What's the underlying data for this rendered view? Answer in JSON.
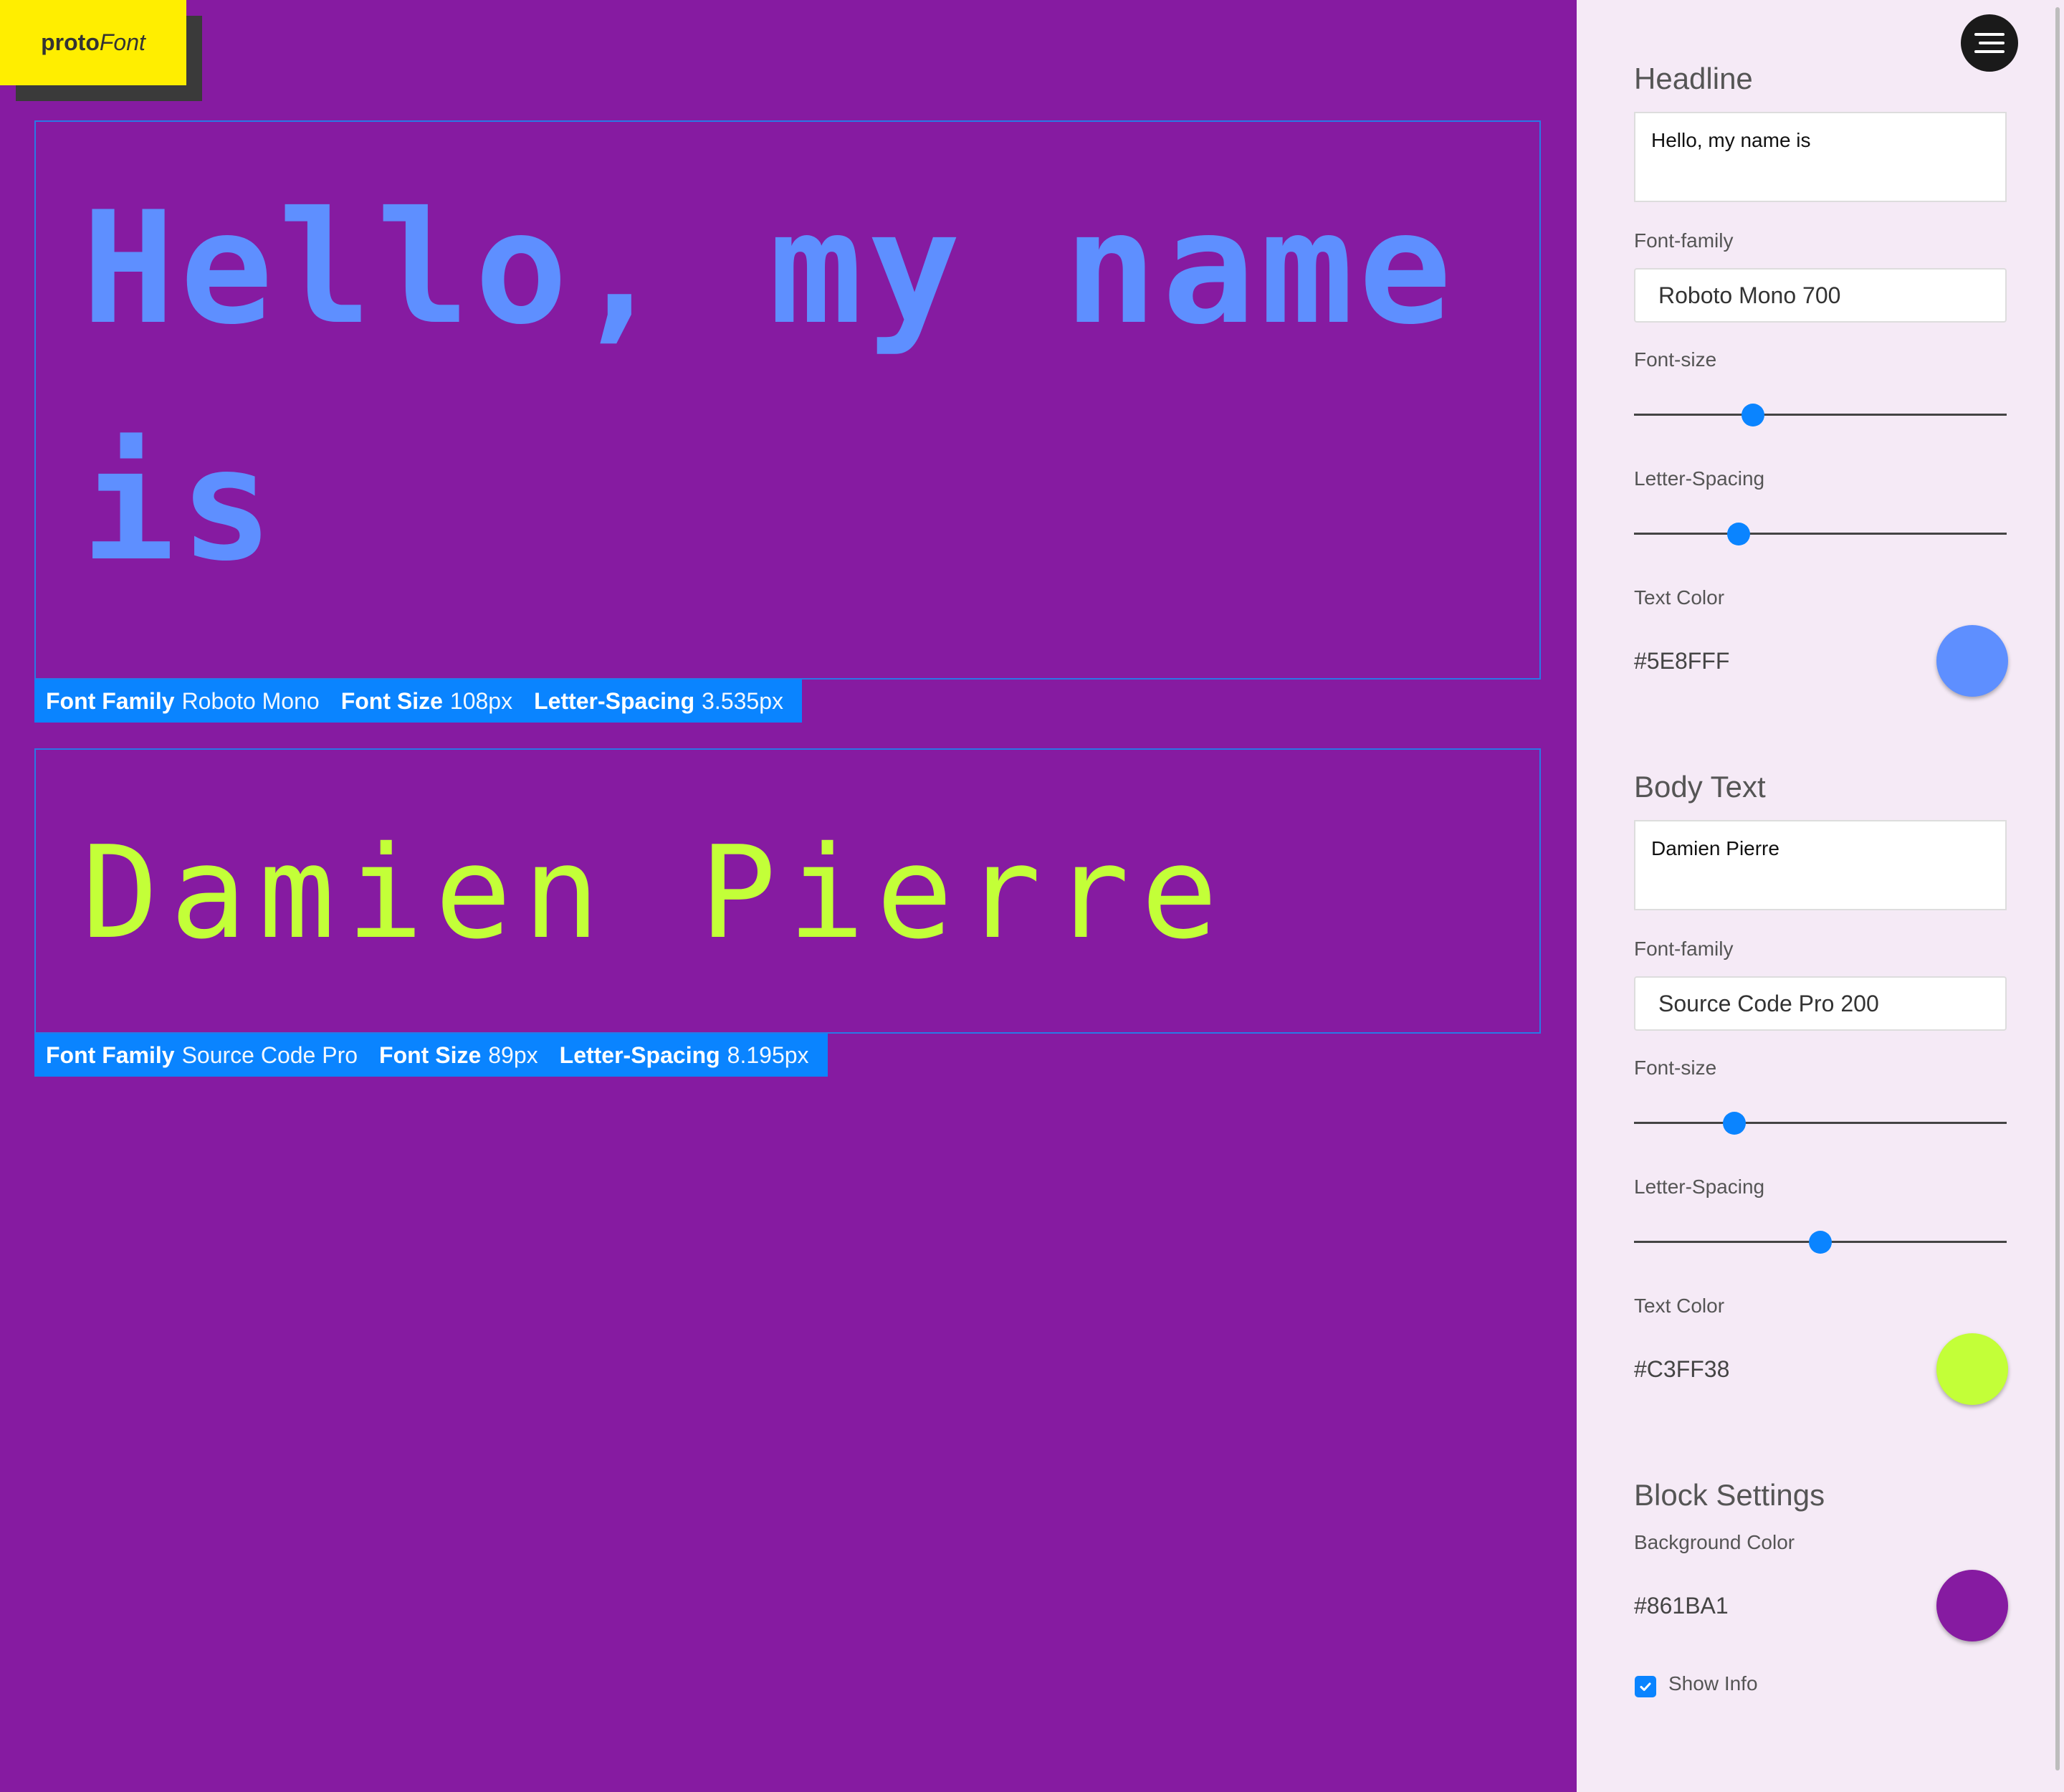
{
  "app": {
    "logo_bold": "proto",
    "logo_italic": "Font"
  },
  "preview": {
    "headline": {
      "text": "Hello, my name is",
      "info": {
        "family_label": "Font Family",
        "family_value": "Roboto Mono",
        "size_label": "Font Size",
        "size_value": "108px",
        "spacing_label": "Letter-Spacing",
        "spacing_value": "3.535px"
      }
    },
    "body": {
      "text": "Damien Pierre",
      "info": {
        "family_label": "Font Family",
        "family_value": "Source Code Pro",
        "size_label": "Font Size",
        "size_value": "89px",
        "spacing_label": "Letter-Spacing",
        "spacing_value": "8.195px"
      }
    }
  },
  "sidebar": {
    "headline": {
      "title": "Headline",
      "text_value": "Hello, my name is",
      "font_family_label": "Font-family",
      "font_family_value": "Roboto Mono 700",
      "font_size_label": "Font-size",
      "font_size_slider_fraction": 0.32,
      "letter_spacing_label": "Letter-Spacing",
      "letter_spacing_slider_fraction": 0.28,
      "text_color_label": "Text Color",
      "text_color_value": "#5E8FFF"
    },
    "body": {
      "title": "Body Text",
      "text_value": "Damien Pierre",
      "font_family_label": "Font-family",
      "font_family_value": "Source Code Pro 200",
      "font_size_label": "Font-size",
      "font_size_slider_fraction": 0.27,
      "letter_spacing_label": "Letter-Spacing",
      "letter_spacing_slider_fraction": 0.5,
      "text_color_label": "Text Color",
      "text_color_value": "#C3FF38"
    },
    "block": {
      "title": "Block Settings",
      "bg_color_label": "Background Color",
      "bg_color_value": "#861BA1",
      "show_info_label": "Show Info",
      "show_info_checked": true
    }
  },
  "colors": {
    "accent": "#0A84FF",
    "logo_bg": "#FFEE00",
    "sidebar_bg": "#F5EAF6"
  },
  "icons": {
    "menu": "hamburger-menu-icon",
    "checkbox": "checkmark-icon"
  }
}
